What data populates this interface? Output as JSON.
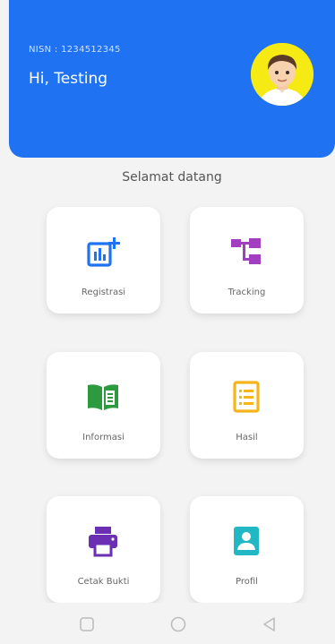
{
  "header": {
    "nisn": "NISN : 1234512345",
    "greeting": "Hi, Testing"
  },
  "welcome": "Selamat datang",
  "menu": [
    {
      "label": "Registrasi",
      "icon": "add-chart-icon",
      "color": "#1f73f2"
    },
    {
      "label": "Tracking",
      "icon": "tree-structure-icon",
      "color": "#a23fc0"
    },
    {
      "label": "Informasi",
      "icon": "open-book-icon",
      "color": "#2e9a3f"
    },
    {
      "label": "Hasil",
      "icon": "list-document-icon",
      "color": "#f4b41a"
    },
    {
      "label": "Cetak Bukti",
      "icon": "printer-icon",
      "color": "#6a2fb3"
    },
    {
      "label": "Profil",
      "icon": "contact-icon",
      "color": "#21b7c4"
    }
  ],
  "colors": {
    "header": "#1f73f2",
    "avatar_bg": "#f6ea15",
    "background": "#f3f3f3"
  },
  "navigation": {
    "icons": [
      "square-recents-icon",
      "circle-home-icon",
      "triangle-back-icon"
    ]
  }
}
